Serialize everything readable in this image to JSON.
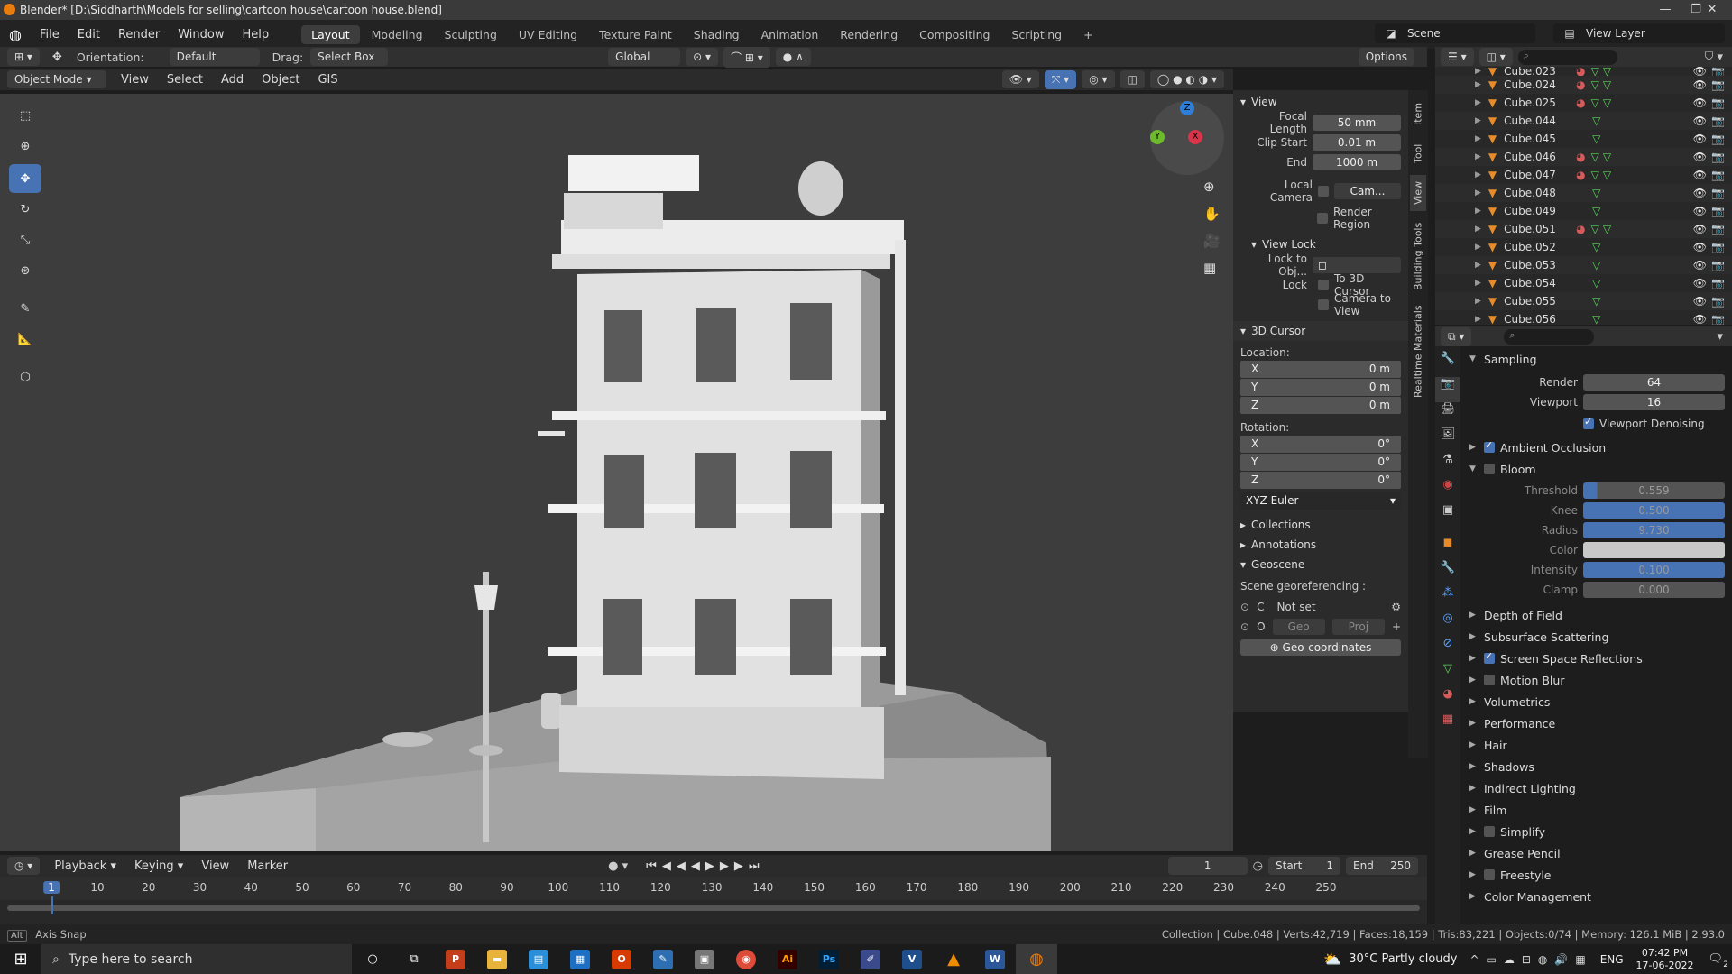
{
  "window": {
    "title": "Blender* [D:\\Siddharth\\Models for selling\\cartoon house\\cartoon house.blend]",
    "min": "—",
    "restore": "❐",
    "close": "✕"
  },
  "menu": {
    "items": [
      "File",
      "Edit",
      "Render",
      "Window",
      "Help"
    ],
    "workspaces": [
      "Layout",
      "Modeling",
      "Sculpting",
      "UV Editing",
      "Texture Paint",
      "Shading",
      "Animation",
      "Rendering",
      "Compositing",
      "Scripting"
    ],
    "add_workspace": "+",
    "scene": "Scene",
    "view_layer": "View Layer"
  },
  "tool_header": {
    "orientation_label": "Orientation:",
    "orientation": "Default",
    "drag_label": "Drag:",
    "drag": "Select Box",
    "transform": "Global",
    "options": "Options"
  },
  "viewport_header": {
    "mode": "Object Mode",
    "menus": [
      "View",
      "Select",
      "Add",
      "Object",
      "GIS"
    ]
  },
  "gizmo": {
    "x": "X",
    "y": "Y",
    "z": "Z"
  },
  "npanel": {
    "view": {
      "title": "View",
      "focal_label": "Focal Length",
      "focal": "50 mm",
      "clip_start_label": "Clip Start",
      "clip_start": "0.01 m",
      "end_label": "End",
      "end": "1000 m",
      "local_camera_label": "Local Camera",
      "local_camera": "Cam...",
      "render_region": "Render Region"
    },
    "view_lock": {
      "title": "View Lock",
      "lock_obj_label": "Lock to Obj...",
      "lock_label": "Lock",
      "to_cursor": "To 3D Cursor",
      "cam_to_view": "Camera to View"
    },
    "cursor": {
      "title": "3D Cursor",
      "location_label": "Location:",
      "loc": [
        {
          "axis": "X",
          "val": "0 m"
        },
        {
          "axis": "Y",
          "val": "0 m"
        },
        {
          "axis": "Z",
          "val": "0 m"
        }
      ],
      "rotation_label": "Rotation:",
      "rot": [
        {
          "axis": "X",
          "val": "0°"
        },
        {
          "axis": "Y",
          "val": "0°"
        },
        {
          "axis": "Z",
          "val": "0°"
        }
      ],
      "rot_mode": "XYZ Euler"
    },
    "collapsed": [
      "Collections",
      "Annotations"
    ],
    "geoscene": {
      "title": "Geoscene",
      "label": "Scene georeferencing :",
      "c": "C",
      "not_set": "Not set",
      "o": "O",
      "geo": "Geo",
      "proj": "Proj",
      "plus": "+",
      "geo_coords": "Geo-coordinates"
    }
  },
  "sidetabs": [
    "Item",
    "Tool",
    "View",
    "Building Tools",
    "Realtime Materials"
  ],
  "outliner": {
    "rows": [
      {
        "name": "Cube.024",
        "mat": true
      },
      {
        "name": "Cube.025",
        "mat": true
      },
      {
        "name": "Cube.044",
        "mat": false
      },
      {
        "name": "Cube.045",
        "mat": false
      },
      {
        "name": "Cube.046",
        "mat": true
      },
      {
        "name": "Cube.047",
        "mat": true
      },
      {
        "name": "Cube.048",
        "mat": false
      },
      {
        "name": "Cube.049",
        "mat": false
      },
      {
        "name": "Cube.051",
        "mat": true
      },
      {
        "name": "Cube.052",
        "mat": false
      },
      {
        "name": "Cube.053",
        "mat": false
      },
      {
        "name": "Cube.054",
        "mat": false
      },
      {
        "name": "Cube.055",
        "mat": false
      },
      {
        "name": "Cube.056",
        "mat": false
      }
    ],
    "top_partial": "Cube.023",
    "sub": "2"
  },
  "props": {
    "sampling": {
      "title": "Sampling",
      "render_label": "Render",
      "render": "64",
      "viewport_label": "Viewport",
      "viewport": "16",
      "denoise": "Viewport Denoising"
    },
    "ao": "Ambient Occlusion",
    "bloom": {
      "title": "Bloom",
      "threshold_label": "Threshold",
      "threshold": "0.559",
      "knee_label": "Knee",
      "knee": "0.500",
      "radius_label": "Radius",
      "radius": "9.730",
      "color_label": "Color",
      "intensity_label": "Intensity",
      "intensity": "0.100",
      "clamp_label": "Clamp",
      "clamp": "0.000"
    },
    "sections": [
      {
        "label": "Depth of Field",
        "chk": null
      },
      {
        "label": "Subsurface Scattering",
        "chk": null
      },
      {
        "label": "Screen Space Reflections",
        "chk": true
      },
      {
        "label": "Motion Blur",
        "chk": false
      },
      {
        "label": "Volumetrics",
        "chk": null
      },
      {
        "label": "Performance",
        "chk": null
      },
      {
        "label": "Hair",
        "chk": null
      },
      {
        "label": "Shadows",
        "chk": null
      },
      {
        "label": "Indirect Lighting",
        "chk": null
      },
      {
        "label": "Film",
        "chk": null
      },
      {
        "label": "Simplify",
        "chk": false
      },
      {
        "label": "Grease Pencil",
        "chk": null
      },
      {
        "label": "Freestyle",
        "chk": false
      },
      {
        "label": "Color Management",
        "chk": null
      }
    ]
  },
  "timeline": {
    "menus": [
      "Playback",
      "Keying",
      "View",
      "Marker"
    ],
    "current": "1",
    "start_label": "Start",
    "start": "1",
    "end_label": "End",
    "end": "250",
    "ticks": [
      "1",
      "10",
      "20",
      "30",
      "40",
      "50",
      "60",
      "70",
      "80",
      "90",
      "100",
      "110",
      "120",
      "130",
      "140",
      "150",
      "160",
      "170",
      "180",
      "190",
      "200",
      "210",
      "220",
      "230",
      "240",
      "250"
    ]
  },
  "status": {
    "left": "Axis Snap",
    "alt": "Alt",
    "right": "Collection | Cube.048 | Verts:42,719 | Faces:18,159 | Tris:83,221 | Objects:0/74 | Memory: 126.1 MiB | 2.93.0"
  },
  "taskbar": {
    "search": "Type here to search",
    "weather": "30°C  Partly cloudy",
    "lang": "ENG",
    "time": "07:42 PM",
    "date": "17-06-2022",
    "notif": "2"
  },
  "colors": {
    "accent": "#4772b3",
    "viewport": "#3d3d3d",
    "panel": "#2b2b2b"
  }
}
